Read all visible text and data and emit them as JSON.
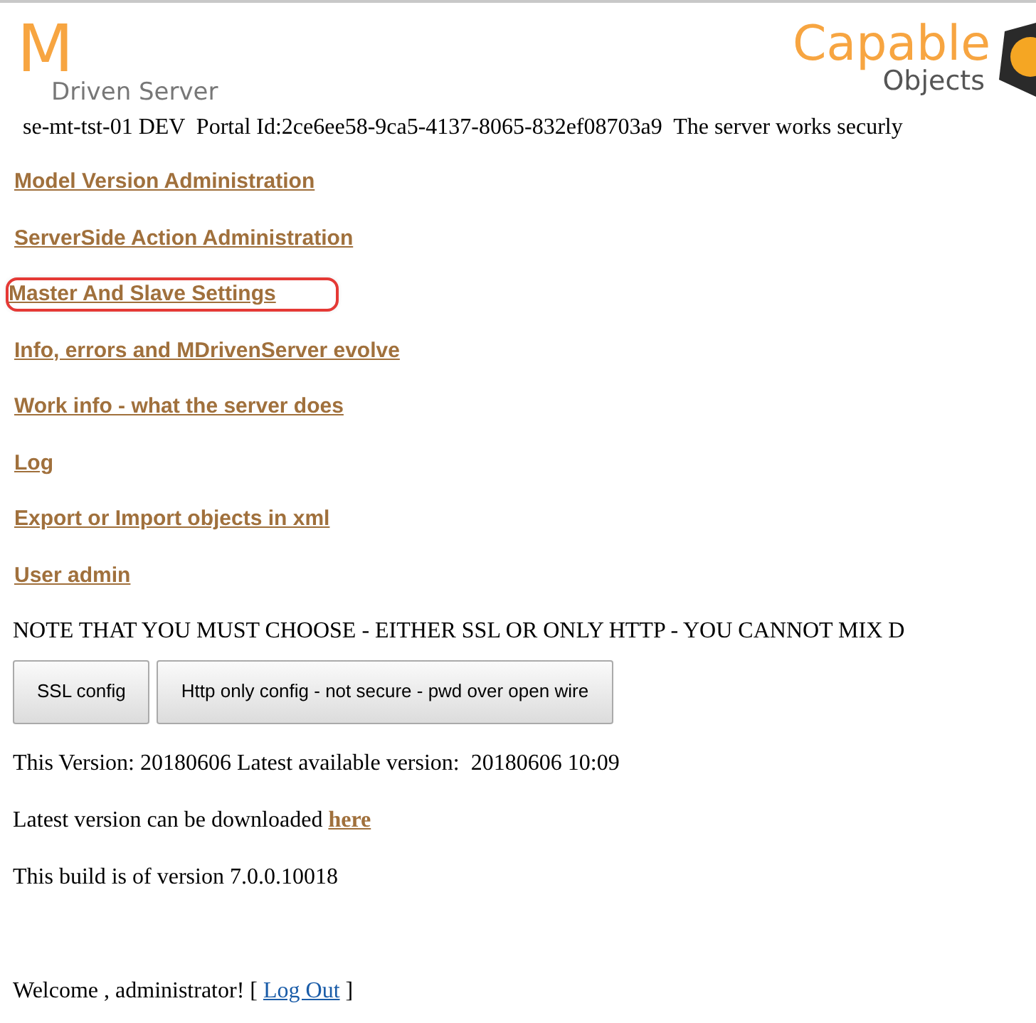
{
  "logo": {
    "letter": "M",
    "subtitle": "Driven Server"
  },
  "brand": {
    "name": "Capable",
    "subtitle": "Objects"
  },
  "info_line": "se-mt-tst-01 DEV  Portal Id:2ce6ee58-9ca5-4137-8065-832ef08703a9  The server works securly",
  "links": [
    {
      "label": "Model Version Administration",
      "highlighted": false
    },
    {
      "label": "ServerSide Action Administration",
      "highlighted": false
    },
    {
      "label": "Master And Slave Settings",
      "highlighted": true
    },
    {
      "label": "Info, errors and MDrivenServer evolve",
      "highlighted": false
    },
    {
      "label": "Work info - what the server does",
      "highlighted": false
    },
    {
      "label": "Log",
      "highlighted": false
    },
    {
      "label": "Export or Import objects in xml",
      "highlighted": false
    },
    {
      "label": "User admin",
      "highlighted": false
    }
  ],
  "note": "NOTE THAT YOU MUST CHOOSE - EITHER SSL OR ONLY HTTP - YOU CANNOT MIX D",
  "buttons": [
    "SSL config",
    "Http only config - not secure - pwd over open wire"
  ],
  "version_line": "This Version: 20180606 Latest available version:  20180606 10:09",
  "download": {
    "text": "Latest version can be downloaded",
    "link": "here"
  },
  "build_line": "This build is of version 7.0.0.10018",
  "welcome": {
    "text": "Welcome , administrator! [",
    "link": "Log Out",
    "end": "]"
  }
}
